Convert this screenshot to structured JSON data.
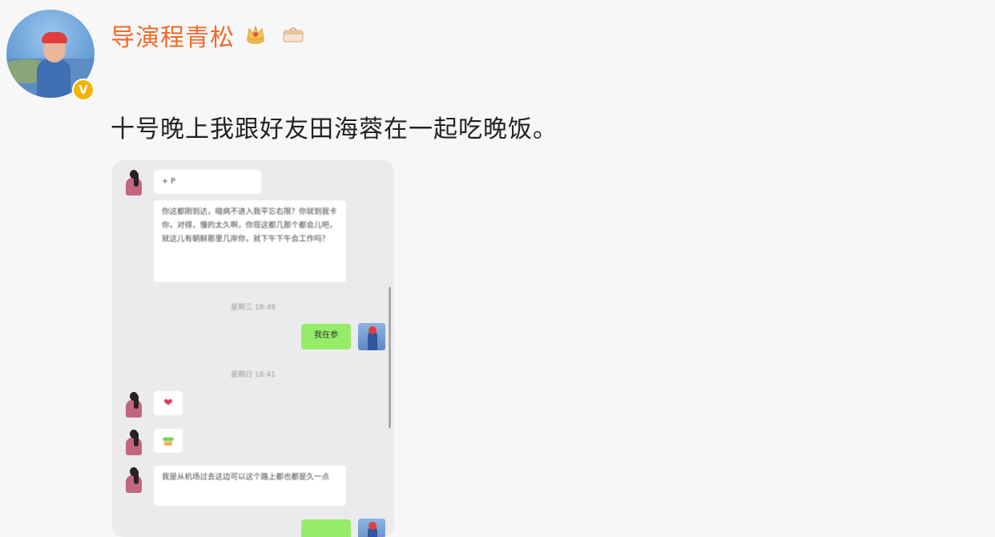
{
  "post": {
    "username": "导演程青松",
    "text": "十号晚上我跟好友田海蓉在一起吃晚饭。",
    "verified_mark": "V"
  },
  "chat": {
    "messages": [
      {
        "side": "left",
        "text": "+ P"
      },
      {
        "side": "left",
        "text": "你这都刚到达，暗病不进入我平忘右限？你就到我卡你，对得，慢的太久啊，你现这都几那个都会儿吧，就这儿有朝鲜那里几岸你，就下午下午会工作吗？"
      },
      {
        "type": "time",
        "text": "星期三 18:49"
      },
      {
        "side": "right",
        "text": "我在参"
      },
      {
        "type": "time",
        "text": "星期日 18:41"
      },
      {
        "side": "left",
        "icon": "heart-icon"
      },
      {
        "side": "left",
        "icon": "sprout-icon"
      },
      {
        "side": "left",
        "text": "我是从机场过去这边可以这个路上都也都是久一点"
      },
      {
        "side": "right",
        "text": ""
      }
    ]
  },
  "colors": {
    "username": "#ee6b2a",
    "verify_badge": "#f5b400",
    "bubble_green": "#95ec69",
    "bubble_white": "#ffffff",
    "chat_bg": "#ebebed"
  }
}
